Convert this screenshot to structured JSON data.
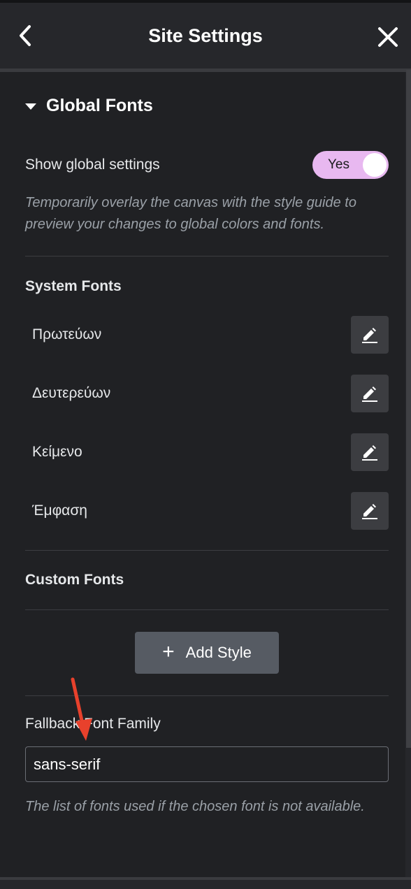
{
  "header": {
    "title": "Site Settings",
    "back_icon": "chevron-left-icon",
    "close_icon": "close-icon"
  },
  "section": {
    "title": "Global Fonts",
    "expanded": true
  },
  "show_global": {
    "label": "Show global settings",
    "toggle_label": "Yes",
    "toggle_on": true,
    "toggle_color": "#e8b8f0",
    "help": "Temporarily overlay the canvas with the style guide to preview your changes to global colors and fonts."
  },
  "system_fonts": {
    "title": "System Fonts",
    "items": [
      {
        "label": "Πρωτεύων"
      },
      {
        "label": "Δευτερεύων"
      },
      {
        "label": "Κείμενο"
      },
      {
        "label": "Έμφαση"
      }
    ]
  },
  "custom_fonts": {
    "title": "Custom Fonts",
    "add_label": "Add Style"
  },
  "fallback": {
    "label": "Fallback Font Family",
    "value": "sans-serif",
    "help": "The list of fonts used if the chosen font is not available."
  },
  "annotation": {
    "arrow_color": "#e8412c"
  }
}
